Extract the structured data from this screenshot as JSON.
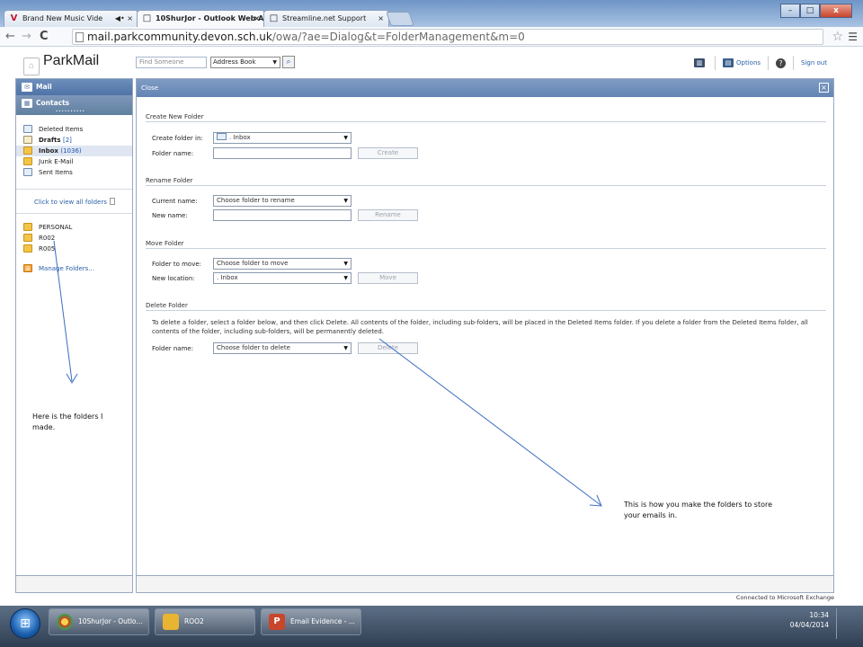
{
  "browser": {
    "tabs": [
      {
        "label": "Brand New Music Vide",
        "extra": "◀• ×"
      },
      {
        "label": "10ShurJor - Outlook Web A",
        "extra": "×"
      },
      {
        "label": "Streamline.net Support",
        "extra": "×"
      }
    ],
    "url_host": "mail.parkcommunity.devon.sch.uk",
    "url_path": "/owa/?ae=Dialog&t=FolderManagement&m=0",
    "window_buttons": [
      "–",
      "□",
      "x"
    ]
  },
  "owa": {
    "logo": "ParkMail",
    "find_placeholder": "Find Someone",
    "address_book": "Address Book",
    "options_label": "Options",
    "signout_label": "Sign out"
  },
  "left": {
    "mail_label": "Mail",
    "contacts_label": "Contacts",
    "dots": "..........",
    "folders": [
      {
        "name": "Deleted Items",
        "count": "",
        "icon": "trash-icon"
      },
      {
        "name": "Drafts",
        "count": "[2]",
        "icon": "draft-icon"
      },
      {
        "name": "Inbox",
        "count": "(1036)",
        "icon": "inbox-icon"
      },
      {
        "name": "Junk E-Mail",
        "count": "",
        "icon": "junk-icon"
      },
      {
        "name": "Sent Items",
        "count": "",
        "icon": "sent-icon"
      }
    ],
    "view_all": "Click to view all folders",
    "personal_folders": [
      "PERSONAL",
      "R002",
      "R005"
    ],
    "manage": "Manage Folders..."
  },
  "main": {
    "header": "Close",
    "create": {
      "title": "Create New Folder",
      "create_in_label": "Create folder in:",
      "create_in_value": ". Inbox",
      "name_label": "Folder name:",
      "button": "Create"
    },
    "rename": {
      "title": "Rename Folder",
      "current_label": "Current name:",
      "current_value": "Choose folder to rename",
      "new_label": "New name:",
      "button": "Rename"
    },
    "move": {
      "title": "Move Folder",
      "move_label": "Folder to move:",
      "move_value": "Choose folder to move",
      "location_label": "New location:",
      "location_value": ". Inbox",
      "button": "Move"
    },
    "delete": {
      "title": "Delete Folder",
      "description": "To delete a folder, select a folder below, and then click Delete. All contents of the folder, including sub-folders, will be placed in the Deleted Items folder. If you delete a folder from the Deleted Items folder, all contents of the folder, including sub-folders, will be permanently deleted.",
      "name_label": "Folder name:",
      "name_value": "Choose folder to delete",
      "button": "Delete"
    },
    "status": "Connected to Microsoft Exchange"
  },
  "annotations": {
    "left_note": "Here is the folders I made.",
    "right_note": "This is how you make the folders to store your emails in."
  },
  "taskbar": {
    "items": [
      "10ShurJor - Outlo...",
      "ROO2",
      "Email Evidence - ..."
    ],
    "time": "10:34",
    "date": "04/04/2014"
  },
  "colors": {
    "header_blue": "#6384b4",
    "link_blue": "#2a5fa8",
    "annotation_line": "#3d6dc2"
  }
}
